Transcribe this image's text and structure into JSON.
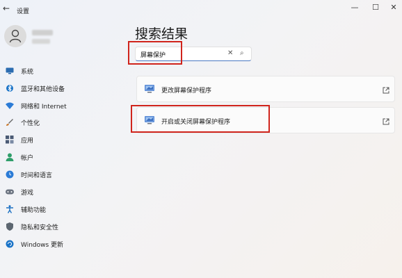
{
  "window": {
    "title": "设置",
    "back_icon": "←",
    "minimize_icon": "—",
    "maximize_icon": "☐",
    "close_icon": "✕"
  },
  "sidebar": {
    "items": [
      {
        "label": "系统",
        "icon": "monitor-icon",
        "color": "#2b6cb0"
      },
      {
        "label": "蓝牙和其他设备",
        "icon": "bluetooth-icon",
        "color": "#1a73c7"
      },
      {
        "label": "网络和 Internet",
        "icon": "wifi-icon",
        "color": "#2b7bd6"
      },
      {
        "label": "个性化",
        "icon": "brush-icon",
        "color": "#c9772b"
      },
      {
        "label": "应用",
        "icon": "apps-icon",
        "color": "#4a5a74"
      },
      {
        "label": "帐户",
        "icon": "account-icon",
        "color": "#2f9e6a"
      },
      {
        "label": "时间和语言",
        "icon": "globe-clock-icon",
        "color": "#2b7bd6"
      },
      {
        "label": "游戏",
        "icon": "gamepad-icon",
        "color": "#6b7380"
      },
      {
        "label": "辅助功能",
        "icon": "accessibility-icon",
        "color": "#1a6fc2"
      },
      {
        "label": "隐私和安全性",
        "icon": "shield-icon",
        "color": "#5c6670"
      },
      {
        "label": "Windows 更新",
        "icon": "update-icon",
        "color": "#1a73c7"
      }
    ]
  },
  "main": {
    "title": "搜索结果",
    "search": {
      "value": "屏幕保护",
      "clear_icon": "✕",
      "search_icon": "⌕"
    },
    "results": [
      {
        "label": "更改屏幕保护程序"
      },
      {
        "label": "开启或关闭屏幕保护程序"
      }
    ]
  },
  "colors": {
    "highlight": "#d0241c",
    "accent": "#4a78c2"
  }
}
